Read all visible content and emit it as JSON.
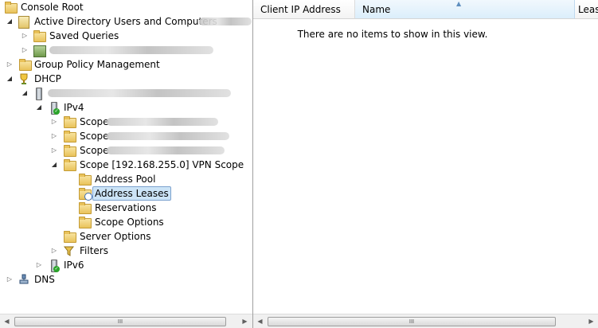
{
  "tree": {
    "console_root": "Console Root",
    "aduc": "Active Directory Users and Computers",
    "saved_queries": "Saved Queries",
    "gpm": "Group Policy Management",
    "dhcp": "DHCP",
    "ipv4": "IPv4",
    "scope_prefix": "Scope",
    "vpn_scope": "Scope [192.168.255.0] VPN Scope",
    "address_pool": "Address Pool",
    "address_leases": "Address Leases",
    "reservations": "Reservations",
    "scope_options": "Scope Options",
    "server_options": "Server Options",
    "filters": "Filters",
    "ipv6": "IPv6",
    "dns": "DNS"
  },
  "list": {
    "columns": [
      "Client IP Address",
      "Name",
      "Leas"
    ],
    "sorted_column": "Name",
    "empty_message": "There are no items to show in this view."
  },
  "scrollbars": {
    "left_arrow": "◀",
    "right_arrow": "▶",
    "grip": "III"
  }
}
